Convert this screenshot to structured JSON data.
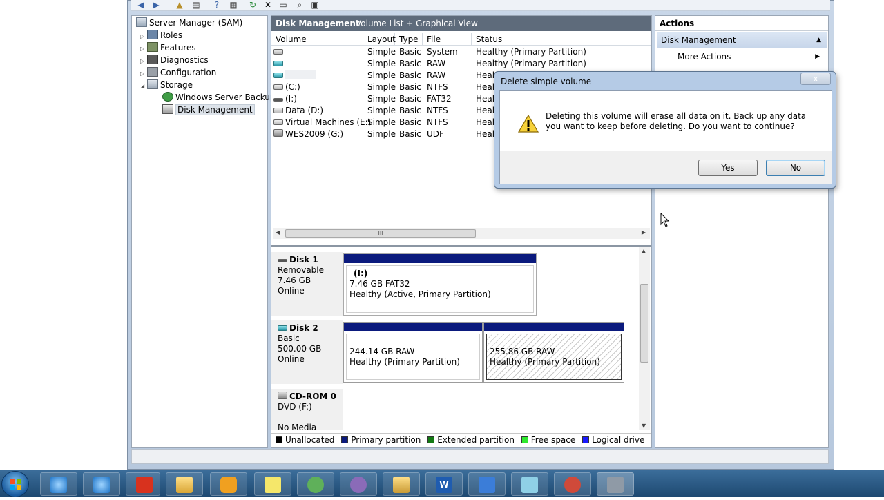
{
  "tree": {
    "items": [
      {
        "label": "Server Manager (SAM)"
      },
      {
        "label": "Roles"
      },
      {
        "label": "Features"
      },
      {
        "label": "Diagnostics"
      },
      {
        "label": "Configuration"
      },
      {
        "label": "Storage"
      },
      {
        "label": "Windows Server Backup"
      },
      {
        "label": "Disk Management"
      }
    ]
  },
  "center": {
    "title": "Disk Management",
    "view": "Volume List + Graphical View",
    "columns": [
      "Volume",
      "Layout",
      "Type",
      "File System",
      "Status"
    ],
    "rows": [
      {
        "volume": "",
        "layout": "Simple",
        "type": "Basic",
        "fs": "",
        "status": "Healthy (Primary Partition)"
      },
      {
        "volume": "",
        "layout": "Simple",
        "type": "Basic",
        "fs": "RAW",
        "status": "Healthy (Primary Partition)"
      },
      {
        "volume": "",
        "layout": "Simple",
        "type": "Basic",
        "fs": "RAW",
        "status": "Healt"
      },
      {
        "volume": "(C:)",
        "layout": "Simple",
        "type": "Basic",
        "fs": "NTFS",
        "status": "Healt"
      },
      {
        "volume": "(I:)",
        "layout": "Simple",
        "type": "Basic",
        "fs": "FAT32",
        "status": "Healt"
      },
      {
        "volume": "Data (D:)",
        "layout": "Simple",
        "type": "Basic",
        "fs": "NTFS",
        "status": "Healt"
      },
      {
        "volume": "Virtual Machines (E:)",
        "layout": "Simple",
        "type": "Basic",
        "fs": "NTFS",
        "status": "Healt"
      },
      {
        "volume": "WES2009 (G:)",
        "layout": "Simple",
        "type": "Basic",
        "fs": "UDF",
        "status": "Healt"
      }
    ],
    "scroll_thumb": "III"
  },
  "disks": [
    {
      "name": "Disk 1",
      "kind": "Removable",
      "size": "7.46 GB",
      "state": "Online",
      "partitions": [
        {
          "line1": "(I:)",
          "line2": "7.46 GB FAT32",
          "line3": "Healthy (Active, Primary Partition)"
        }
      ]
    },
    {
      "name": "Disk 2",
      "kind": "Basic",
      "size": "500.00 GB",
      "state": "Online",
      "partitions": [
        {
          "line1": "244.14 GB RAW",
          "line2": "Healthy (Primary Partition)"
        },
        {
          "line1": "255.86 GB RAW",
          "line2": "Healthy (Primary Partition)"
        }
      ]
    },
    {
      "name": "CD-ROM 0",
      "kind": "DVD (F:)",
      "state": "No Media"
    }
  ],
  "legend": [
    {
      "label": "Unallocated",
      "color": "#000000"
    },
    {
      "label": "Primary partition",
      "color": "#0b1a7d"
    },
    {
      "label": "Extended partition",
      "color": "#137a13"
    },
    {
      "label": "Free space",
      "color": "#2ee82e"
    },
    {
      "label": "Logical drive",
      "color": "#1a1aff"
    }
  ],
  "actions": {
    "title": "Actions",
    "section": "Disk Management",
    "more": "More Actions"
  },
  "dialog": {
    "title": "Delete simple volume",
    "message": "Deleting this volume will erase all data on it. Back up any data you want to keep before deleting. Do you want to continue?",
    "yes": "Yes",
    "no": "No",
    "close": "x"
  },
  "taskbar": {
    "apps": [
      "ie-icon",
      "ie-icon",
      "app-red-icon",
      "explorer-icon",
      "media-icon",
      "sticky-notes-icon",
      "network-icon",
      "messenger-icon",
      "folder-icon",
      "word-icon",
      "journal-icon",
      "notepad-icon",
      "paint-icon",
      "server-manager-icon"
    ]
  }
}
